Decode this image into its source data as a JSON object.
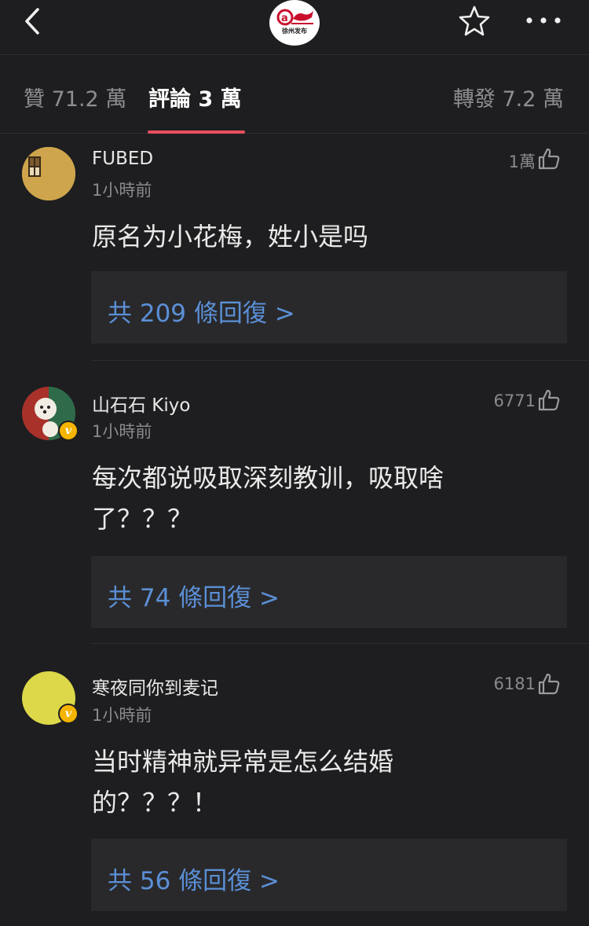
{
  "header": {
    "brand_text": "徐州发布",
    "icons": [
      "back-chevron-icon",
      "brand-logo",
      "star-icon",
      "more-icon"
    ]
  },
  "tabs": [
    {
      "label": "贊 71.2 萬",
      "active": false
    },
    {
      "label": "評論 3 萬",
      "active": true
    },
    {
      "label": "轉發 7.2 萬",
      "active": false
    }
  ],
  "colors": {
    "background": "#1e1e20",
    "accent_indicator": "#e94f5f",
    "link_blue": "#5b8fd6",
    "reply_box": "#29292b",
    "verified_badge": "#f4b400"
  },
  "comments": [
    {
      "username": "FUBED",
      "time": "1小時前",
      "likes": "1萬",
      "text_lines": [
        "原名为小花梅，姓小是吗"
      ],
      "replies": "共 209 條回復 >",
      "verified": false
    },
    {
      "username": "山石石 Kiyo",
      "time": "1小時前",
      "likes": "6771",
      "text_lines": [
        "每次都说吸取深刻教训，吸取啥",
        "了？？？"
      ],
      "replies": "共 74 條回復 >",
      "verified": true
    },
    {
      "username": "寒夜同你到麦记",
      "time": "1小時前",
      "likes": "6181",
      "text_lines": [
        "当时精神就异常是怎么结婚",
        "的？？？！"
      ],
      "replies": "共 56 條回復 >",
      "verified": true
    }
  ]
}
